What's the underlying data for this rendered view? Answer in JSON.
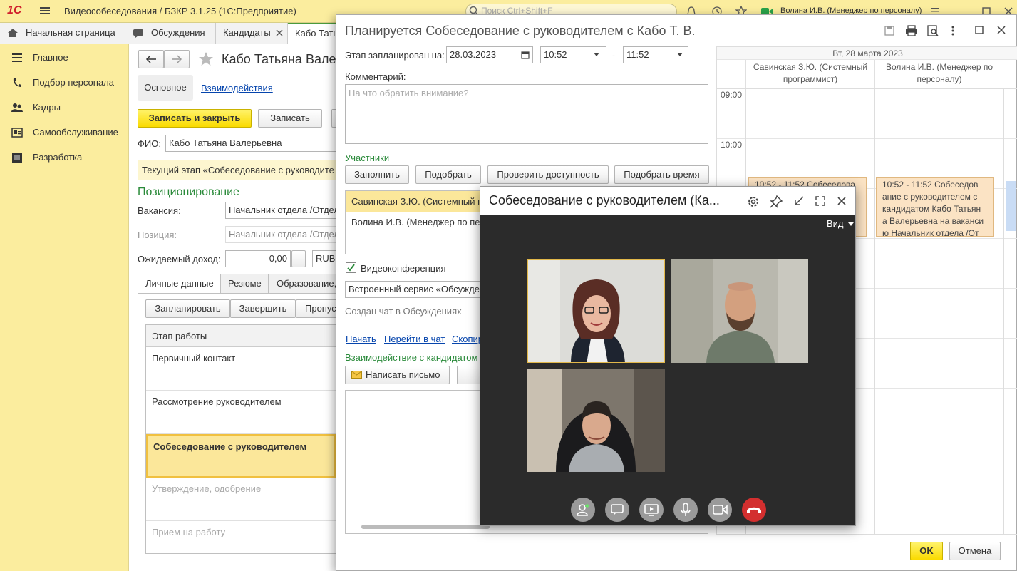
{
  "titlebar": {
    "logo": "1С",
    "app_title": "Видеособеседования / БЗКР 3.1.25  (1С:Предприятие)",
    "search_placeholder": "Поиск Ctrl+Shift+F",
    "user": "Волина И.В. (Менеджер по персоналу)"
  },
  "tabs": [
    {
      "label": "Начальная страница"
    },
    {
      "label": "Обсуждения"
    },
    {
      "label": "Кандидаты"
    },
    {
      "label": "Кабо Татья"
    }
  ],
  "sidebar": {
    "items": [
      {
        "label": "Главное",
        "icon": "list-icon"
      },
      {
        "label": "Подбор персонала",
        "icon": "phone-icon"
      },
      {
        "label": "Кадры",
        "icon": "people-icon"
      },
      {
        "label": "Самообслуживание",
        "icon": "card-icon"
      },
      {
        "label": "Разработка",
        "icon": "square-icon"
      }
    ]
  },
  "candidate": {
    "title": "Кабо Татьяна Вале",
    "nav_tabs": {
      "main": "Основное",
      "interactions": "Взаимодействия"
    },
    "save_close": "Записать и закрыть",
    "save": "Записать",
    "fio_label": "ФИО:",
    "fio_value": "Кабо Татьяна Валерьевна",
    "stage_notice": "Текущий этап «Собеседование с руководите",
    "section_positioning": "Позиционирование",
    "vacancy_label": "Вакансия:",
    "vacancy_value": "Начальник отдела /Отдел",
    "position_label": "Позиция:",
    "position_value": "Начальник отдела /Отдел",
    "income_label": "Ожидаемый доход:",
    "income_value": "0,00",
    "currency": "RUB",
    "subtabs": [
      "Личные данные",
      "Резюме",
      "Образование,"
    ],
    "actions": {
      "plan": "Запланировать",
      "finish": "Завершить",
      "skip": "Пропус"
    },
    "stages_header": "Этап работы",
    "stages": [
      {
        "label": "Первичный контакт",
        "state": "done"
      },
      {
        "label": "Рассмотрение руководителем",
        "state": "done"
      },
      {
        "label": "Собеседование с руководителем",
        "state": "current"
      },
      {
        "label": "Утверждение, одобрение",
        "state": "future"
      },
      {
        "label": "Прием на работу",
        "state": "future"
      }
    ]
  },
  "dialog": {
    "title": "Планируется Собеседование с руководителем с Кабо Т. В.",
    "date_label": "Этап запланирован на:",
    "date": "28.03.2023",
    "time_from": "10:52",
    "time_sep": "-",
    "time_to": "11:52",
    "comment_label": "Комментарий:",
    "comment_placeholder": "На что обратить внимание?",
    "participants_label": "Участники",
    "buttons": {
      "fill": "Заполнить",
      "pick": "Подобрать",
      "check": "Проверить доступность",
      "pick_time": "Подобрать время"
    },
    "participants": [
      {
        "name": "Савинская З.Ю. (Системный п"
      },
      {
        "name": "Волина И.В. (Менеджер по пе"
      }
    ],
    "video_checkbox": "Видеоконференция",
    "video_checked": true,
    "service_value": "Встроенный сервис «Обсужде",
    "chat_created": "Создан чат в Обсуждениях",
    "links": {
      "start": "Начать",
      "go_chat": "Перейти в чат",
      "copy": "Скопир"
    },
    "interaction_label": "Взаимодействие с кандидатом",
    "write_letter": "Написать письмо",
    "ok": "OK",
    "cancel": "Отмена"
  },
  "calendar": {
    "date_header": "Вт, 28 марта 2023",
    "columns": [
      "Савинская З.Ю. (Системный программист)",
      "Волина И.В. (Менеджер по персоналу)"
    ],
    "hours": [
      "09:00",
      "10:00"
    ],
    "events": [
      {
        "text": "10:52 - 11:52 Собеседова ние с руководителем с кандидатом Кабо В Н р"
      },
      {
        "text": "10:52 - 11:52 Собеседов ание с руководителем с кандидатом Кабо Татьян а Валерьевна на ваканси ю Начальник отдела /От"
      }
    ]
  },
  "video": {
    "title": "Собеседование с руководителем (Ка...",
    "view_label": "Вид",
    "participants": [
      {
        "name": "participant-1"
      },
      {
        "name": "participant-2"
      },
      {
        "name": "participant-3"
      }
    ],
    "controls": [
      "add-person-icon",
      "chat-icon",
      "screen-share-icon",
      "microphone-icon",
      "camera-icon",
      "hangup-icon"
    ]
  },
  "colors": {
    "accent_yellow": "#fbed9e",
    "green": "#2a8a3a",
    "event_bg": "#fbe3c4",
    "hangup": "#d32f2f"
  }
}
